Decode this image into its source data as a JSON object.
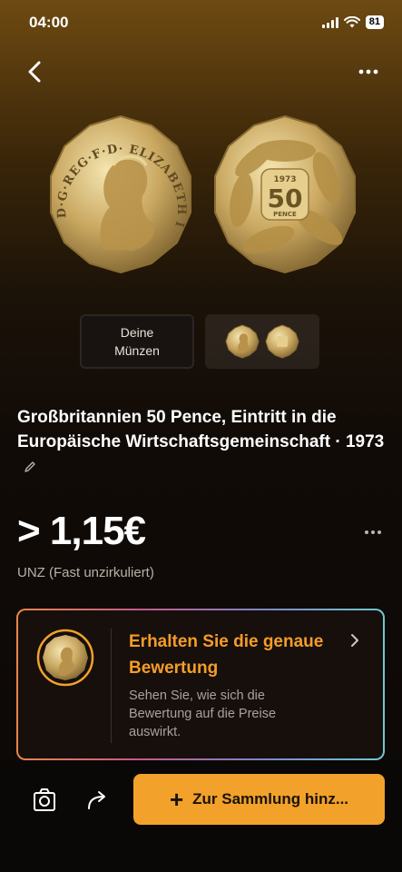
{
  "status": {
    "time": "04:00",
    "battery": "81"
  },
  "thumbs": {
    "your_coins": "Deine Münzen"
  },
  "coin": {
    "obverse_legend": "D·G·REG·F·D· ELIZABETH II",
    "reverse_year": "1973",
    "reverse_value": "50",
    "reverse_unit": "PENCE",
    "title": "Großbritannien 50 Pence, Eintritt in die Europäische Wirtschaftsgemeinschaft · 1973",
    "price": "> 1,15€",
    "condition": "UNZ (Fast unzirkuliert)"
  },
  "valuation_card": {
    "title": "Erhalten Sie die genaue Bewertung",
    "subtitle": "Sehen Sie, wie sich die Bewertung auf die Preise auswirkt."
  },
  "bottom_bar": {
    "add_label": "Zur Sammlung hinz..."
  },
  "colors": {
    "accent": "#f2a12b",
    "card_title": "#f59c2a"
  }
}
